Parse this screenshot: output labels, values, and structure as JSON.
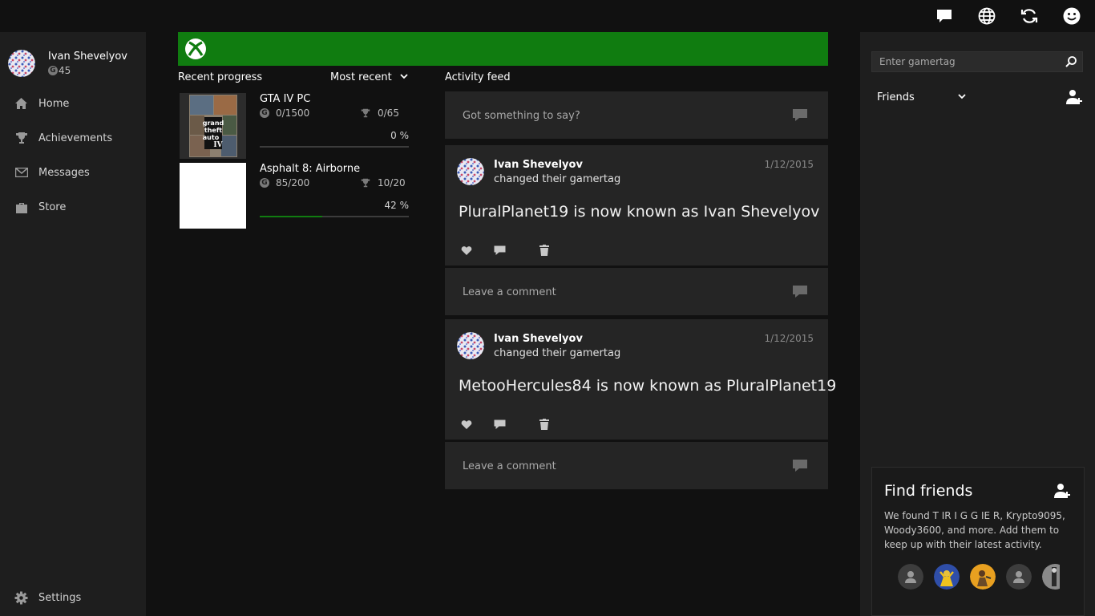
{
  "profile": {
    "name": "Ivan Shevelyov",
    "gamerscore_badge": "G",
    "gamerscore": "45"
  },
  "topbar": {
    "icons": [
      "messages-icon",
      "globe-icon",
      "refresh-icon",
      "smiley-icon"
    ]
  },
  "nav": {
    "items": [
      {
        "label": "Home",
        "icon": "home-icon"
      },
      {
        "label": "Achievements",
        "icon": "trophy-icon"
      },
      {
        "label": "Messages",
        "icon": "mail-icon"
      },
      {
        "label": "Store",
        "icon": "store-icon"
      }
    ],
    "settings_label": "Settings"
  },
  "recent": {
    "title": "Recent progress",
    "sort": "Most recent",
    "games": [
      {
        "title": "GTA IV PC",
        "gamerscore": "0/1500",
        "achievements": "0/65",
        "percent": "0 %",
        "progress": 0,
        "thumb_text": [
          "grand",
          "theft",
          "auto",
          "IV"
        ]
      },
      {
        "title": "Asphalt 8: Airborne",
        "gamerscore": "85/200",
        "achievements": "10/20",
        "percent": "42 %",
        "progress": 0.42
      }
    ]
  },
  "feed": {
    "title": "Activity feed",
    "compose_placeholder": "Got something to say?",
    "comment_placeholder": "Leave a comment",
    "posts": [
      {
        "name": "Ivan Shevelyov",
        "action": "changed their gamertag",
        "date": "1/12/2015",
        "body": "PluralPlanet19 is now known as Ivan Shevelyov"
      },
      {
        "name": "Ivan Shevelyov",
        "action": "changed their gamertag",
        "date": "1/12/2015",
        "body": "MetooHercules84 is now known as PluralPlanet19"
      }
    ]
  },
  "right": {
    "search_placeholder": "Enter gamertag",
    "friends_label": "Friends",
    "find_friends": {
      "title": "Find friends",
      "description": "We found T IR I G G IE R, Krypto9095, Woody3600, and more.  Add them to keep up with their latest activity."
    }
  },
  "colors": {
    "accent": "#107c10",
    "background": "#111111",
    "panel": "#1e1e1e",
    "card": "#252525"
  }
}
